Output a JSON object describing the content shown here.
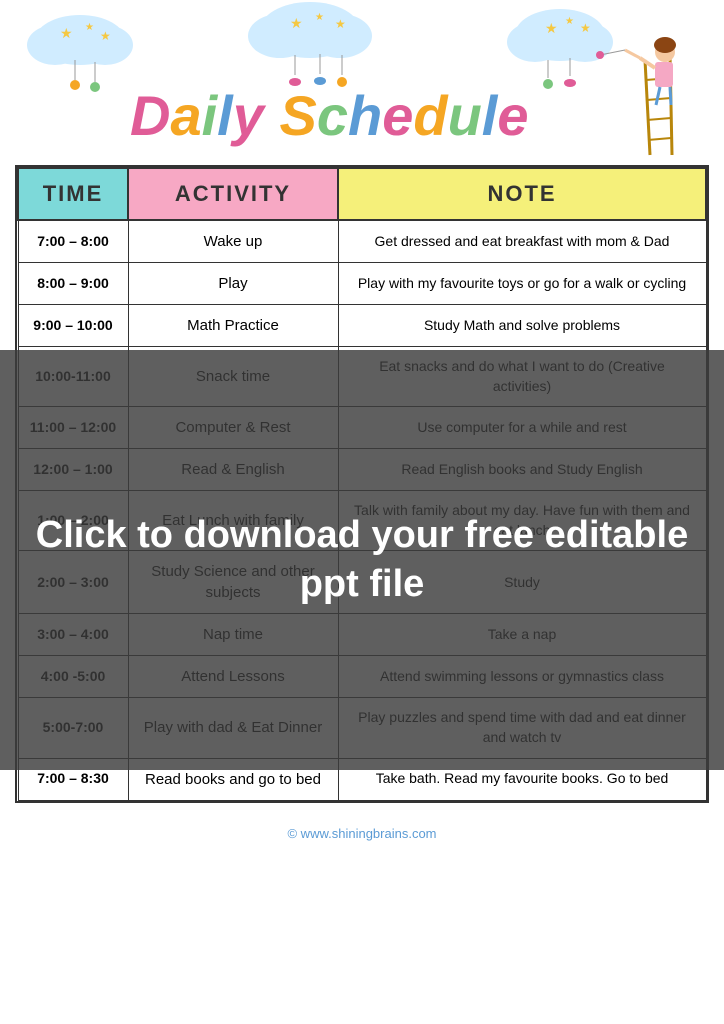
{
  "header": {
    "title_part1": "Daily",
    "title_part2": "Schedule",
    "title_full": "Daily Schedule"
  },
  "table": {
    "columns": [
      "TIME",
      "ACTIVITY",
      "NOTE"
    ],
    "rows": [
      {
        "time": "7:00 – 8:00",
        "activity": "Wake up",
        "note": "Get dressed and eat breakfast with mom & Dad"
      },
      {
        "time": "8:00 – 9:00",
        "activity": "Play",
        "note": "Play with my favourite toys or go for a walk or cycling"
      },
      {
        "time": "9:00 – 10:00",
        "activity": "Math Practice",
        "note": "Study Math and solve problems"
      },
      {
        "time": "10:00-11:00",
        "activity": "Snack time",
        "note": "Eat snacks and do what I want to do (Creative activities)"
      },
      {
        "time": "11:00 – 12:00",
        "activity": "Computer & Rest",
        "note": "Use computer for a while and rest"
      },
      {
        "time": "12:00 – 1:00",
        "activity": "Read & English",
        "note": "Read English books and Study English"
      },
      {
        "time": "1:00 – 2:00",
        "activity": "Eat Lunch with family",
        "note": "Talk with family about my day. Have fun with them and eat lunch"
      },
      {
        "time": "2:00 – 3:00",
        "activity": "Study Science and other subjects",
        "note": "Study"
      },
      {
        "time": "3:00 – 4:00",
        "activity": "Nap time",
        "note": "Take a nap"
      },
      {
        "time": "4:00 -5:00",
        "activity": "Attend Lessons",
        "note": "Attend swimming lessons or gymnastics class"
      },
      {
        "time": "5:00-7:00",
        "activity": "Play with dad & Eat Dinner",
        "note": "Play puzzles and spend time with dad and eat dinner and watch tv"
      },
      {
        "time": "7:00 – 8:30",
        "activity": "Read books and go to bed",
        "note": "Take bath. Read my favourite books. Go to bed"
      }
    ]
  },
  "overlay": {
    "text": "Click to download your free editable ppt file"
  },
  "footer": {
    "link_text": "© www.shiningbrains.com"
  }
}
